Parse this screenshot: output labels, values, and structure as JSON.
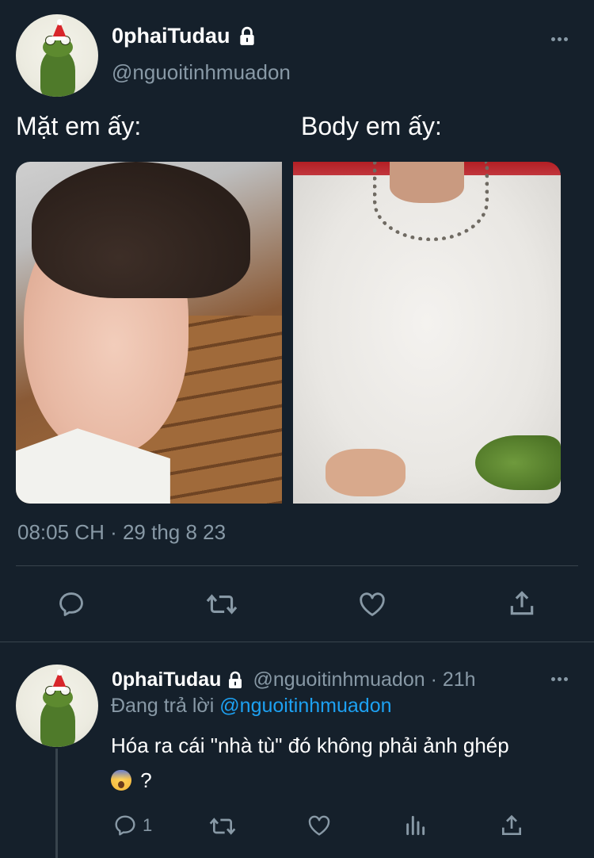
{
  "main_tweet": {
    "display_name": "0phaiTudau",
    "handle": "@nguoitinhmuadon",
    "caption_left": "Mặt em ấy:",
    "caption_right": "Body em ấy:",
    "timestamp": "08:05 CH · 29 thg 8 23",
    "icons": [
      "lock-icon",
      "more-icon",
      "reply-icon",
      "retweet-icon",
      "like-icon",
      "share-icon"
    ]
  },
  "reply_tweet": {
    "display_name": "0phaiTudau",
    "handle_time": "@nguoitinhmuadon · 21h",
    "replying_prefix": "Đang trả lời",
    "replying_mention": "@nguoitinhmuadon",
    "text": "Hóa ra cái \"nhà tù\" đó không phải ảnh ghép",
    "text_tail": "?",
    "reply_count": "1",
    "icons": [
      "lock-icon",
      "more-icon",
      "reply-icon",
      "retweet-icon",
      "like-icon",
      "analytics-icon",
      "share-icon",
      "scared-face-emoji"
    ]
  },
  "colors": {
    "background": "#15202b",
    "text_primary": "#ffffff",
    "text_secondary": "#8899a6",
    "accent": "#1da1f2",
    "divider": "#38444d"
  }
}
